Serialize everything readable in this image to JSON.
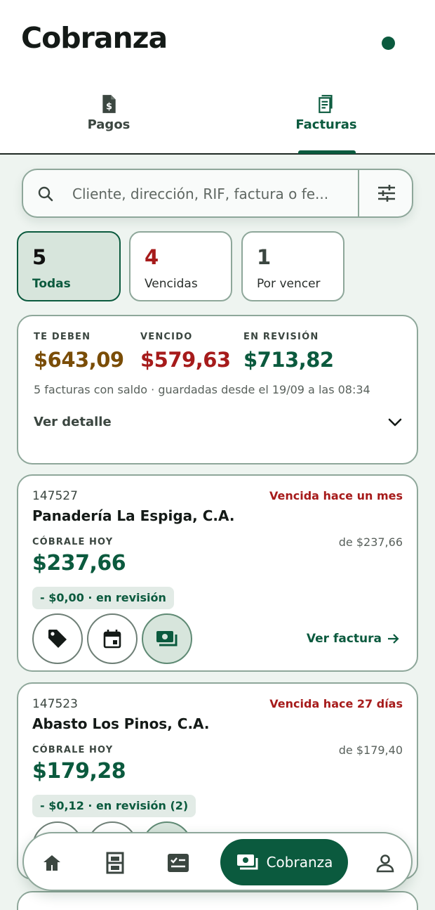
{
  "header": {
    "title": "Cobranza"
  },
  "tabs": [
    {
      "label": "Pagos",
      "icon": "receipt-dollar-icon"
    },
    {
      "label": "Facturas",
      "icon": "invoice-icon",
      "active": true
    }
  ],
  "search": {
    "placeholder": "Cliente, dirección, RIF, factura o fe..."
  },
  "filters": [
    {
      "count": "5",
      "label": "Todas",
      "selected": true
    },
    {
      "count": "4",
      "label": "Vencidas"
    },
    {
      "count": "1",
      "label": "Por vencer"
    }
  ],
  "summary": {
    "te_deben_label": "TE DEBEN",
    "te_deben_value": "$643,09",
    "vencido_label": "VENCIDO",
    "vencido_value": "$579,63",
    "revision_label": "EN REVISIÓN",
    "revision_value": "$713,82",
    "note": "5 facturas con saldo · guardadas desde el 19/09 a las 08:34",
    "detail_label": "Ver detalle"
  },
  "invoices": [
    {
      "number": "147527",
      "status": "Vencida hace un mes",
      "client": "Panadería La Espiga, C.A.",
      "cobrale_label": "CÓBRALE HOY",
      "total": "de $237,66",
      "amount": "$237,66",
      "review": "- $0,00 · en revisión",
      "view_label": "Ver factura"
    },
    {
      "number": "147523",
      "status": "Vencida hace 27 días",
      "client": "Abasto Los Pinos, C.A.",
      "cobrale_label": "CÓBRALE HOY",
      "total": "de $179,40",
      "amount": "$179,28",
      "review": "- $0,12 · en revisión (2)"
    }
  ],
  "bottom_nav": {
    "active_label": "Cobranza",
    "items": [
      "home-icon",
      "shelf-icon",
      "checklist-icon",
      "cash-icon",
      "profile-icon"
    ]
  },
  "colors": {
    "primary": "#0b5a3e",
    "danger": "#a61b1b",
    "warning": "#7a4d07",
    "background": "#eef4f0"
  }
}
